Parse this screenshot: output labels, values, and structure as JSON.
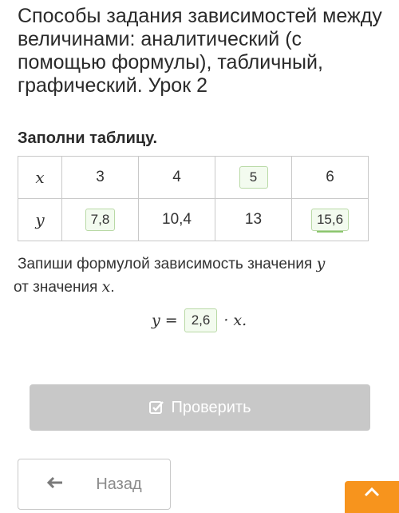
{
  "lesson": {
    "title": "Способы задания зависимостей между величинами: аналитический (с помощью формулы), табличный, графический. Урок 2"
  },
  "task": {
    "heading": "Заполни таблицу.",
    "table": {
      "x_label": "x",
      "y_label": "y",
      "x_values": [
        "3",
        "4",
        "5",
        "6"
      ],
      "y_values": [
        "7,8",
        "10,4",
        "13",
        "15,6"
      ]
    },
    "instruction_part1": "Запиши формулой зависимость значения ",
    "instruction_var_y": "y",
    "instruction_part2": " от значения ",
    "instruction_var_x": "x",
    "instruction_end": ".",
    "formula": {
      "lhs": "y =",
      "coefficient": "2,6",
      "rhs": "· x."
    }
  },
  "buttons": {
    "check_label": "Проверить",
    "back_label": "Назад"
  },
  "icons": {
    "check": "check-square-icon",
    "back": "arrow-left-icon",
    "up": "chevron-up-icon"
  },
  "colors": {
    "answer_border": "#b9d9a6",
    "check_button": "#c8c8c8",
    "accent_orange": "#f7941d"
  }
}
